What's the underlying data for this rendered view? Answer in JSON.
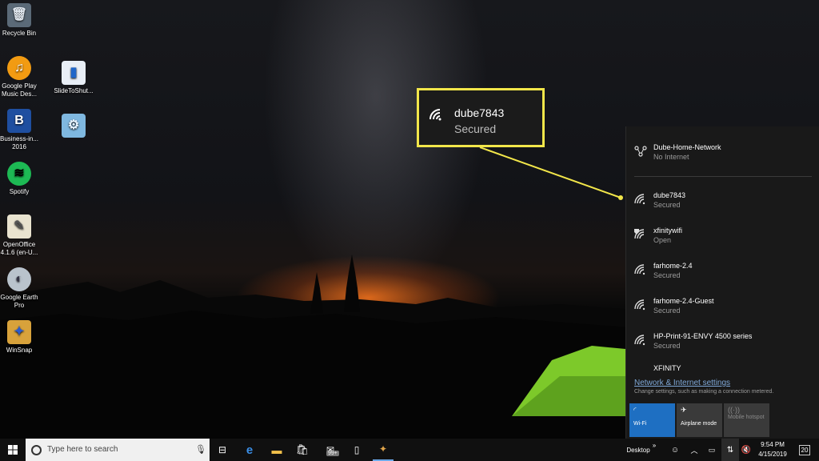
{
  "desktop": {
    "icons": [
      {
        "label": "Recycle Bin",
        "icon": "recycle-bin-icon"
      },
      {
        "label": "Google Play Music Des...",
        "icon": "headphones-icon"
      },
      {
        "label": "Business-in... 2016",
        "icon": "b-icon"
      },
      {
        "label": "Spotify",
        "icon": "spotify-icon"
      },
      {
        "label": "OpenOffice 4.1.6 (en-U...",
        "icon": "openoffice-icon"
      },
      {
        "label": "Google Earth Pro",
        "icon": "globe-icon"
      },
      {
        "label": "WinSnap",
        "icon": "winsnap-icon"
      },
      {
        "label": "SlideToShut...",
        "icon": "shortcut-icon"
      },
      {
        "label": "",
        "icon": "control-panel-icon"
      }
    ]
  },
  "callout": {
    "name": "dube7843",
    "status": "Secured"
  },
  "flyout": {
    "connected": {
      "name": "Dube-Home-Network",
      "status": "No Internet"
    },
    "networks": [
      {
        "name": "dube7843",
        "status": "Secured"
      },
      {
        "name": "xfinitywifi",
        "status": "Open"
      },
      {
        "name": "farhome-2.4",
        "status": "Secured"
      },
      {
        "name": "farhome-2.4-Guest",
        "status": "Secured"
      },
      {
        "name": "HP-Print-91-ENVY 4500 series",
        "status": "Secured"
      },
      {
        "name": "XFINITY",
        "status": ""
      }
    ],
    "settings_link": "Network & Internet settings",
    "settings_desc": "Change settings, such as making a connection metered.",
    "quick_actions": [
      {
        "label": "Wi-Fi",
        "color": "#1e6fc2"
      },
      {
        "label": "Airplane mode",
        "color": "#3a3a3a"
      },
      {
        "label": "Mobile hotspot",
        "color": "#3a3a3a"
      }
    ]
  },
  "taskbar": {
    "search_placeholder": "Type here to search",
    "store_badge": "99+",
    "desktop_label": "Desktop",
    "time": "9:54 PM",
    "date": "4/15/2019",
    "notification_count": "20"
  },
  "colors": {
    "accent": "#1e6fc2",
    "callout_border": "#f2e64a"
  }
}
